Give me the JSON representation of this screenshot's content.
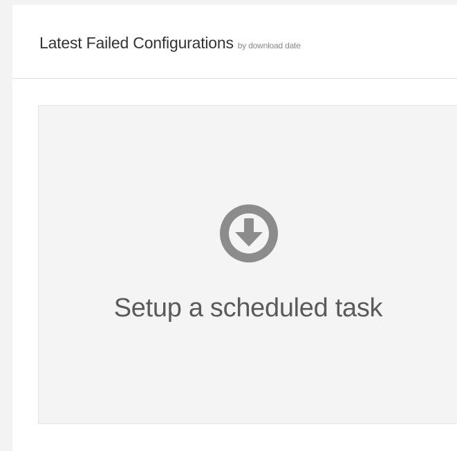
{
  "panel": {
    "title": "Latest Failed Configurations",
    "subtitle": "by download date"
  },
  "empty_state": {
    "icon": "download-circle-icon",
    "message": "Setup a scheduled task",
    "icon_color": "#8c8c8c"
  }
}
